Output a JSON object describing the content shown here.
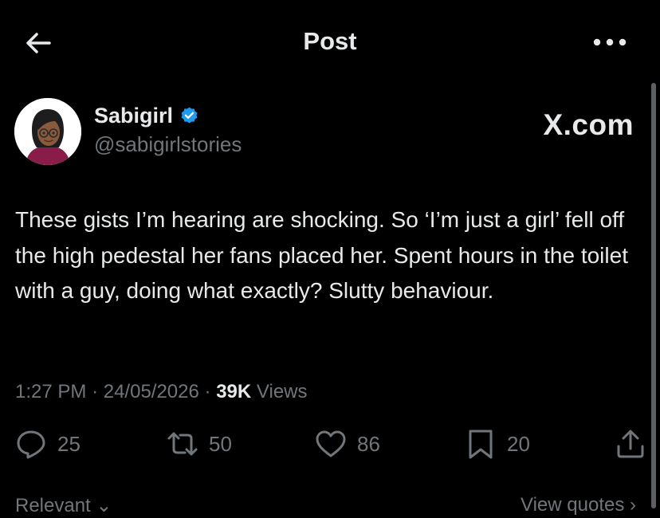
{
  "header": {
    "title": "Post",
    "back_icon": "arrow-left-icon",
    "more_icon": "more-horizontal-icon"
  },
  "author": {
    "display_name": "Sabigirl",
    "handle": "@sabigirlstories",
    "verified": true,
    "verified_color": "#1d9bf0",
    "avatar_icon": "cartoon-avatar"
  },
  "brand": "X.com",
  "post": {
    "text": "These gists I’m hearing are shocking. So ‘I’m just a girl’ fell off the high pedestal her fans placed her. Spent hours in the toilet with a guy, doing what exactly? Slutty behaviour.",
    "time": "1:27 PM",
    "date": "24/05/2026",
    "separator": "·",
    "views_count": "39K",
    "views_label": "Views"
  },
  "actions": {
    "replies": "25",
    "reposts": "50",
    "likes": "86",
    "bookmarks": "20"
  },
  "footer": {
    "relevant": "Relevant ⌄",
    "view_quotes": "View quotes ›"
  },
  "colors": {
    "background": "#000000",
    "text": "#e7e9ea",
    "muted": "#71767b"
  }
}
